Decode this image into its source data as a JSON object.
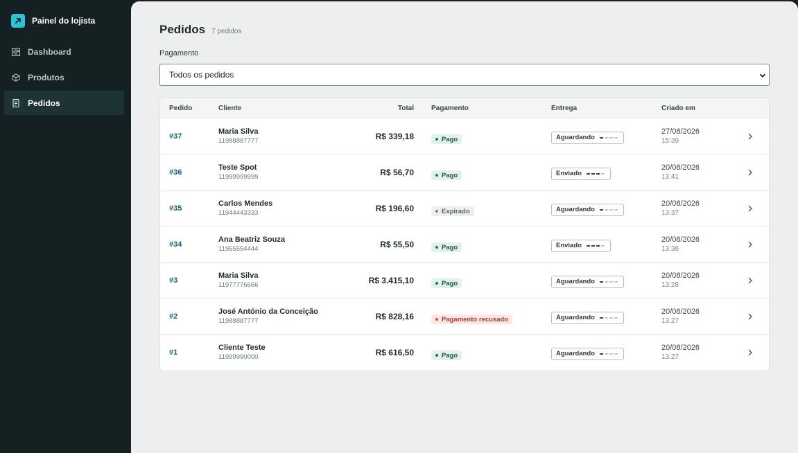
{
  "app": {
    "brand": "Painel do lojista",
    "accent": "#2fc4d4"
  },
  "sidebar": {
    "items": [
      {
        "label": "Dashboard",
        "icon": "grid-icon",
        "active": false
      },
      {
        "label": "Produtos",
        "icon": "box-icon",
        "active": false
      },
      {
        "label": "Pedidos",
        "icon": "receipt-icon",
        "active": true
      }
    ]
  },
  "page": {
    "title": "Pedidos",
    "count": "7 pedidos"
  },
  "filter": {
    "label": "Pagamento",
    "selected": "Todos os pedidos"
  },
  "table": {
    "headers": {
      "pedido": "Pedido",
      "cliente": "Cliente",
      "total": "Total",
      "pagamento": "Pagamento",
      "entrega": "Entrega",
      "criado": "Criado em"
    },
    "rows": [
      {
        "id": "#37",
        "name": "Maria Silva",
        "phone": "11988887777",
        "total": "R$ 339,18",
        "payment": "Pago",
        "payment_status": "ok",
        "shipping": "Aguardando",
        "shipping_step": 1,
        "date": "27/08/2026",
        "time": "15:39"
      },
      {
        "id": "#36",
        "name": "Teste Spot",
        "phone": "11999999999",
        "total": "R$ 56,70",
        "payment": "Pago",
        "payment_status": "ok",
        "shipping": "Enviado",
        "shipping_step": 3,
        "date": "20/08/2026",
        "time": "13:41"
      },
      {
        "id": "#35",
        "name": "Carlos Mendes",
        "phone": "11944443333",
        "total": "R$ 196,60",
        "payment": "Expirado",
        "payment_status": "gray",
        "shipping": "Aguardando",
        "shipping_step": 1,
        "date": "20/08/2026",
        "time": "13:37"
      },
      {
        "id": "#34",
        "name": "Ana Beatriz Souza",
        "phone": "11955554444",
        "total": "R$ 55,50",
        "payment": "Pago",
        "payment_status": "ok",
        "shipping": "Enviado",
        "shipping_step": 3,
        "date": "20/08/2026",
        "time": "13:36"
      },
      {
        "id": "#3",
        "name": "Maria Silva",
        "phone": "11977776666",
        "total": "R$ 3.415,10",
        "payment": "Pago",
        "payment_status": "ok",
        "shipping": "Aguardando",
        "shipping_step": 1,
        "date": "20/08/2026",
        "time": "13:28"
      },
      {
        "id": "#2",
        "name": "José António da Conceição",
        "phone": "11988887777",
        "total": "R$ 828,16",
        "payment": "Pagamento recusado",
        "payment_status": "err",
        "shipping": "Aguardando",
        "shipping_step": 1,
        "date": "20/08/2026",
        "time": "13:27"
      },
      {
        "id": "#1",
        "name": "Cliente Teste",
        "phone": "11999990000",
        "total": "R$ 616,50",
        "payment": "Pago",
        "payment_status": "ok",
        "shipping": "Aguardando",
        "shipping_step": 1,
        "date": "20/08/2026",
        "time": "13:27"
      }
    ]
  }
}
